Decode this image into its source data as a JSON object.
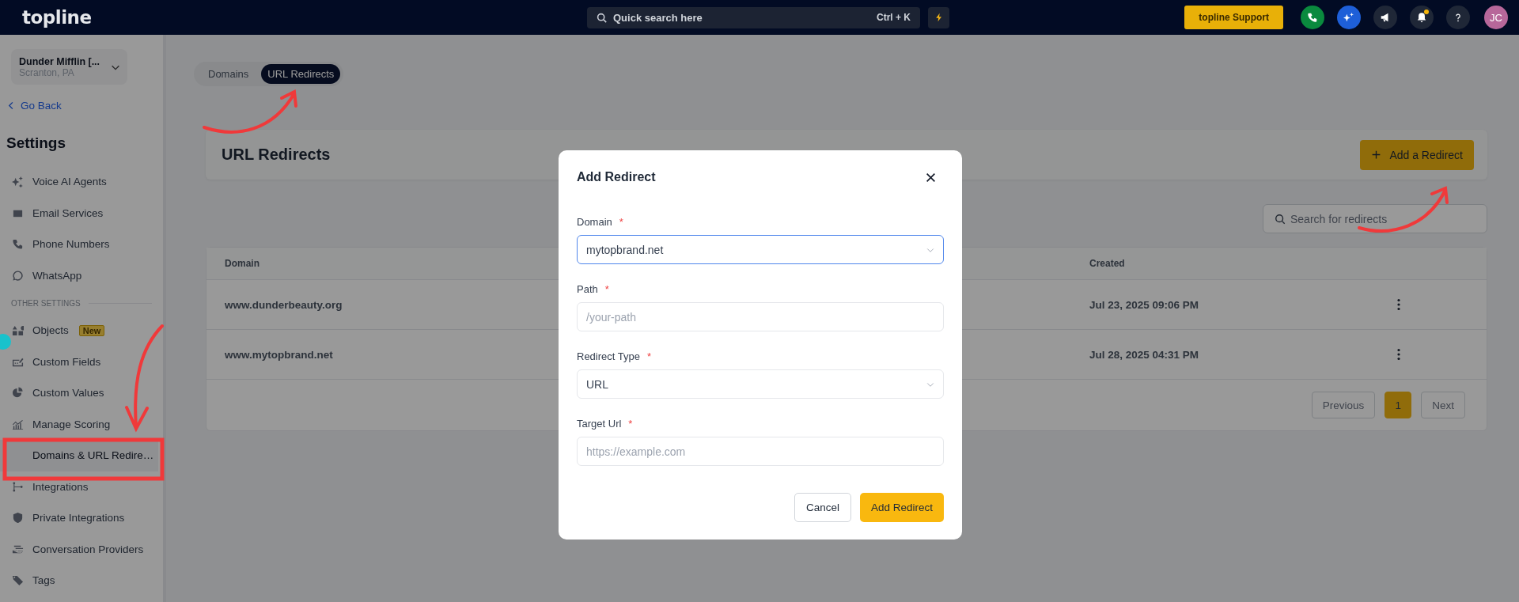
{
  "topbar": {
    "logo": "topline",
    "search": {
      "placeholder": "Quick search here",
      "shortcut": "Ctrl + K"
    },
    "support_button": "topline Support",
    "notification_unread": true,
    "avatar": "JC"
  },
  "sidebar": {
    "account": {
      "name": "Dunder Mifflin [...",
      "location": "Scranton, PA"
    },
    "back_link": "Go Back",
    "heading": "Settings",
    "items": [
      {
        "label": "Voice AI Agents",
        "selected": false
      },
      {
        "label": "Email Services",
        "selected": false
      },
      {
        "label": "Phone Numbers",
        "selected": false
      },
      {
        "label": "WhatsApp",
        "selected": false
      }
    ],
    "other_settings": {
      "label": "OTHER SETTINGS",
      "items": [
        {
          "label": "Objects",
          "selected": false,
          "badge": "New"
        },
        {
          "label": "Custom Fields",
          "selected": false
        },
        {
          "label": "Custom Values",
          "selected": false
        },
        {
          "label": "Manage Scoring",
          "selected": false
        },
        {
          "label": "Domains & URL Redire…",
          "selected": true
        },
        {
          "label": "Integrations",
          "selected": false
        },
        {
          "label": "Private Integrations",
          "selected": false
        },
        {
          "label": "Conversation Providers",
          "selected": false
        },
        {
          "label": "Tags",
          "selected": false
        }
      ]
    }
  },
  "tabs": [
    {
      "label": "Domains",
      "selected": false
    },
    {
      "label": "URL Redirects",
      "selected": true
    }
  ],
  "page_header": {
    "title": "URL Redirects",
    "add_button": "Add a Redirect"
  },
  "search": {
    "placeholder": "Search for redirects"
  },
  "table": {
    "columns": [
      "Domain",
      "Created"
    ],
    "rows": [
      {
        "domain": "www.dunderbeauty.org",
        "created": "Jul 23, 2025 09:06 PM"
      },
      {
        "domain": "www.mytopbrand.net",
        "created": "Jul 28, 2025 04:31 PM"
      }
    ]
  },
  "pagination": {
    "previous": "Previous",
    "pages": [
      {
        "label": "1",
        "selected": true
      }
    ],
    "next": "Next"
  },
  "modal": {
    "title": "Add Redirect",
    "fields": [
      {
        "label": "Domain",
        "required_mark": "*",
        "kind": "select",
        "value": "mytopbrand.net",
        "focused": true
      },
      {
        "label": "Path",
        "required_mark": "*",
        "kind": "text",
        "placeholder": "/your-path",
        "focused": false
      },
      {
        "label": "Redirect Type",
        "required_mark": "*",
        "kind": "select",
        "value": "URL",
        "focused": false
      },
      {
        "label": "Target Url",
        "required_mark": "*",
        "kind": "text",
        "placeholder": "https://example.com",
        "focused": false
      }
    ],
    "cancel_button": "Cancel",
    "submit_button": "Add Redirect"
  }
}
